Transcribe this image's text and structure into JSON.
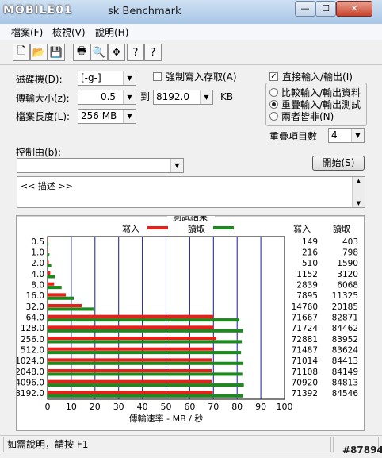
{
  "window": {
    "logo_text": "MOBILE01",
    "title": "sk Benchmark",
    "min_glyph": "—",
    "max_glyph": "☐",
    "close_glyph": "✕"
  },
  "menu": [
    "檔案(F)",
    "檢視(V)",
    "說明(H)"
  ],
  "toolbar_icons": [
    "new-doc-icon",
    "open-folder-icon",
    "save-icon",
    "print-icon",
    "print-preview-icon",
    "move-icon",
    "help-icon",
    "context-help-icon"
  ],
  "toolbar_glyphs": [
    "🗋",
    "📂",
    "💾",
    "🖶",
    "🔍",
    "✥",
    "?",
    "?"
  ],
  "form": {
    "drive_label": "磁碟機(D):",
    "drive_value": "[-g-]",
    "force_write_label": "強制寫入存取(A)",
    "force_write_checked": false,
    "direct_io_label": "直接輸入/輸出(I)",
    "direct_io_checked": true,
    "transfer_label": "傳輸大小(z):",
    "transfer_from": "0.5",
    "to_label": "到",
    "transfer_to": "8192.0",
    "unit": "KB",
    "length_label": "檔案長度(L):",
    "length_value": "256 MB",
    "radio_compare": "比較輸入/輸出資料",
    "radio_overlap": "重疊輸入/輸出測試",
    "radio_neither": "兩者皆非(N)",
    "selected_radio": "overlap",
    "queue_label": "重疊項目數",
    "queue_value": "4",
    "control_label": "控制由(b):",
    "control_value": "",
    "start_label": "開始(S)",
    "desc_text": "<<    描述    >>"
  },
  "chart_data": {
    "type": "bar",
    "title": "測試結果",
    "xlabel": "傳輸速率 - MB / 秒",
    "ylabel": "",
    "xlim": [
      0,
      100
    ],
    "xticks": [
      0,
      10,
      20,
      30,
      40,
      50,
      60,
      70,
      80,
      90,
      100
    ],
    "categories": [
      "0.5",
      "1.0",
      "2.0",
      "4.0",
      "8.0",
      "16.0",
      "32.0",
      "64.0",
      "128.0",
      "256.0",
      "512.0",
      "1024.0",
      "2048.0",
      "4096.0",
      "8192.0"
    ],
    "series": [
      {
        "name": "寫入",
        "color": "#e8201a",
        "values": [
          0.15,
          0.21,
          0.5,
          1.13,
          2.77,
          7.71,
          14.41,
          69.99,
          70.04,
          71.17,
          69.81,
          69.35,
          69.44,
          69.26,
          69.72
        ]
      },
      {
        "name": "讀取",
        "color": "#1c8a1c",
        "values": [
          0.39,
          0.78,
          1.55,
          3.05,
          5.93,
          11.06,
          19.71,
          80.93,
          82.48,
          81.98,
          81.66,
          82.44,
          82.18,
          82.83,
          82.56
        ]
      }
    ],
    "table_headers": [
      "寫入",
      "讀取"
    ],
    "table_rows": [
      [
        "149",
        "403"
      ],
      [
        "216",
        "798"
      ],
      [
        "510",
        "1590"
      ],
      [
        "1152",
        "3120"
      ],
      [
        "2839",
        "6068"
      ],
      [
        "7895",
        "11325"
      ],
      [
        "14760",
        "20185"
      ],
      [
        "71667",
        "82871"
      ],
      [
        "71724",
        "84462"
      ],
      [
        "72881",
        "83952"
      ],
      [
        "71487",
        "83624"
      ],
      [
        "71014",
        "84413"
      ],
      [
        "71108",
        "84149"
      ],
      [
        "70920",
        "84813"
      ],
      [
        "71392",
        "84546"
      ]
    ]
  },
  "status": {
    "text": "如需說明，請按 F1",
    "watermark": "#87894"
  }
}
